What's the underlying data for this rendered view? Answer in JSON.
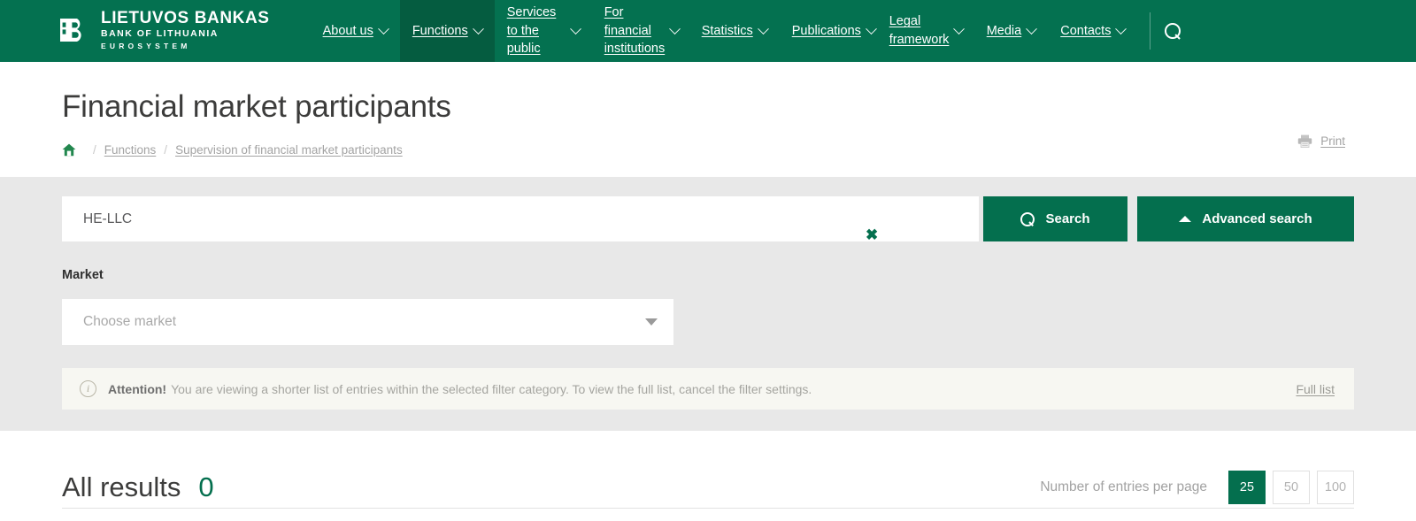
{
  "header": {
    "brand": {
      "mark_icon": "lb-monogram-icon",
      "line1": "LIETUVOS BANKAS",
      "line2": "BANK OF LITHUANIA",
      "line3": "EUROSYSTEM"
    },
    "nav_items": [
      {
        "label": "About us",
        "active": false,
        "has_caret": true
      },
      {
        "label": "Functions",
        "active": true,
        "has_caret": true
      },
      {
        "label": "Services to the public",
        "active": false,
        "has_caret": true
      },
      {
        "label": "For financial institutions",
        "active": false,
        "has_caret": true
      },
      {
        "label": "Statistics",
        "active": false,
        "has_caret": true
      },
      {
        "label": "Publications",
        "active": false,
        "has_caret": true
      },
      {
        "label": "Legal framework",
        "active": false,
        "has_caret": true
      },
      {
        "label": "Media",
        "active": false,
        "has_caret": true
      },
      {
        "label": "Contacts",
        "active": false,
        "has_caret": true
      }
    ],
    "search_icon": "search-icon",
    "brand_color": "#046f4e",
    "active_nav_color": "#055c40"
  },
  "page": {
    "title": "Financial market participants",
    "breadcrumb": {
      "home_icon": "home-icon",
      "separator": "/",
      "items": [
        {
          "label": "Functions"
        },
        {
          "label": "Supervision of financial market participants"
        }
      ]
    },
    "print": {
      "icon": "printer-icon",
      "label": "Print"
    }
  },
  "filters": {
    "search": {
      "value": "HE-LLC",
      "placeholder": "",
      "clear_label": "✖",
      "search_button": "Search",
      "search_icon": "search-icon",
      "advanced_button": "Advanced search",
      "advanced_icon": "caret-up-icon"
    },
    "market": {
      "label": "Market",
      "placeholder": "Choose market",
      "value": "",
      "dropdown_icon": "chevron-down-icon"
    },
    "alert": {
      "icon": "info-icon",
      "strong": "Attention!",
      "text": "You are viewing a shorter list of entries within the selected filter category. To view the full list, cancel the filter settings.",
      "link": "Full list"
    }
  },
  "results": {
    "title": "All results",
    "count": "0",
    "per_page_label": "Number of entries per page",
    "per_page_options": [
      {
        "value": "25",
        "active": true
      },
      {
        "value": "50",
        "active": false
      },
      {
        "value": "100",
        "active": false
      }
    ]
  }
}
